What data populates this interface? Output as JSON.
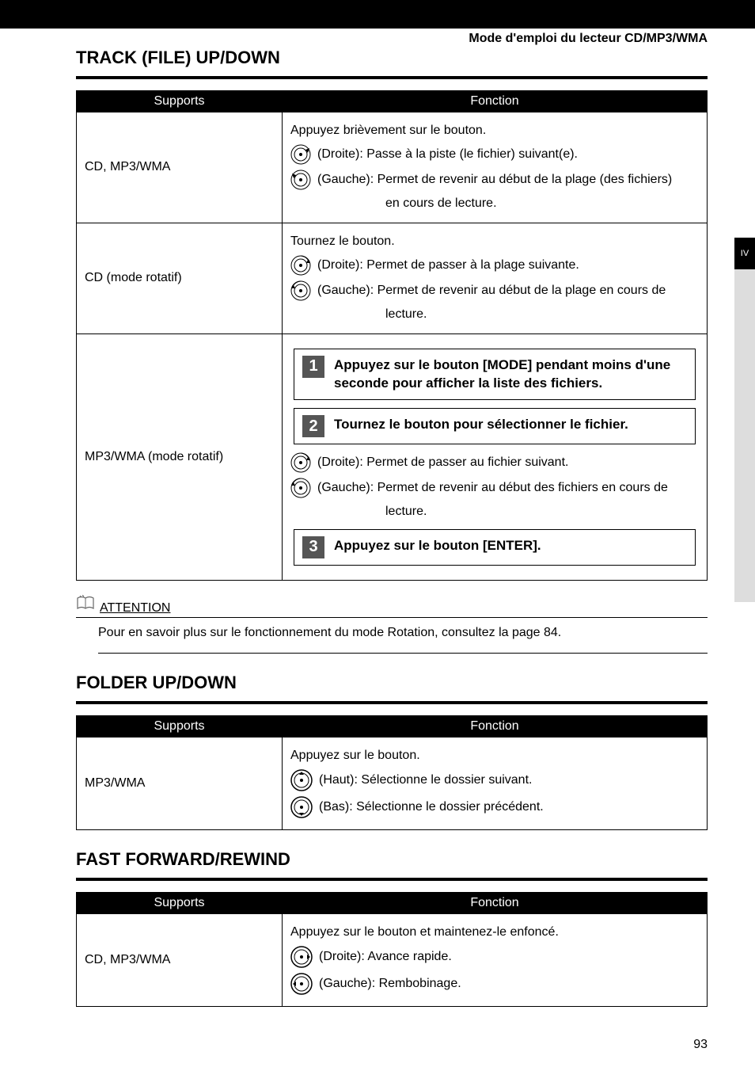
{
  "breadcrumb": "Mode d'emploi du lecteur CD/MP3/WMA",
  "side_tab": "IV",
  "page_number": "93",
  "sections": {
    "track": {
      "title": "TRACK (FILE) UP/DOWN",
      "headers": {
        "supports": "Supports",
        "fonction": "Fonction"
      },
      "rows": [
        {
          "support": "CD, MP3/WMA",
          "intro": "Appuyez brièvement sur le bouton.",
          "right": "(Droite): Passe à la piste (le fichier) suivant(e).",
          "left": "(Gauche): Permet de revenir au début de la plage (des fichiers) en cours de lecture.",
          "left_extra": "en cours de lecture."
        },
        {
          "support": "CD (mode rotatif)",
          "intro": "Tournez le bouton.",
          "right": "(Droite): Permet de passer à la plage suivante.",
          "left": "(Gauche): Permet de revenir au début de la plage en cours de lecture.",
          "left_extra": "lecture."
        },
        {
          "support": "MP3/WMA (mode rotatif)",
          "step1": "Appuyez sur le bouton [MODE] pendant moins d'une seconde pour afficher la liste des fichiers.",
          "step2": "Tournez le bouton pour sélectionner le fichier.",
          "right": "(Droite): Permet de passer au fichier suivant.",
          "left": "(Gauche):  Permet de revenir au début des fichiers en cours de lecture.",
          "left_extra": "lecture.",
          "step3": "Appuyez sur le bouton [ENTER]."
        }
      ]
    },
    "attention": {
      "label": "ATTENTION",
      "body": "Pour en savoir plus sur le fonctionnement du mode Rotation, consultez la page 84."
    },
    "folder": {
      "title": "FOLDER UP/DOWN",
      "headers": {
        "supports": "Supports",
        "fonction": "Fonction"
      },
      "row": {
        "support": "MP3/WMA",
        "intro": "Appuyez sur le bouton.",
        "up": "(Haut): Sélectionne le dossier suivant.",
        "down": "(Bas): Sélectionne le dossier précédent."
      }
    },
    "fast": {
      "title": "FAST FORWARD/REWIND",
      "headers": {
        "supports": "Supports",
        "fonction": "Fonction"
      },
      "row": {
        "support": "CD, MP3/WMA",
        "intro": "Appuyez sur le bouton et maintenez-le enfoncé.",
        "right": "(Droite): Avance rapide.",
        "left": "(Gauche): Rembobinage."
      }
    }
  },
  "step_numbers": {
    "one": "1",
    "two": "2",
    "three": "3"
  }
}
